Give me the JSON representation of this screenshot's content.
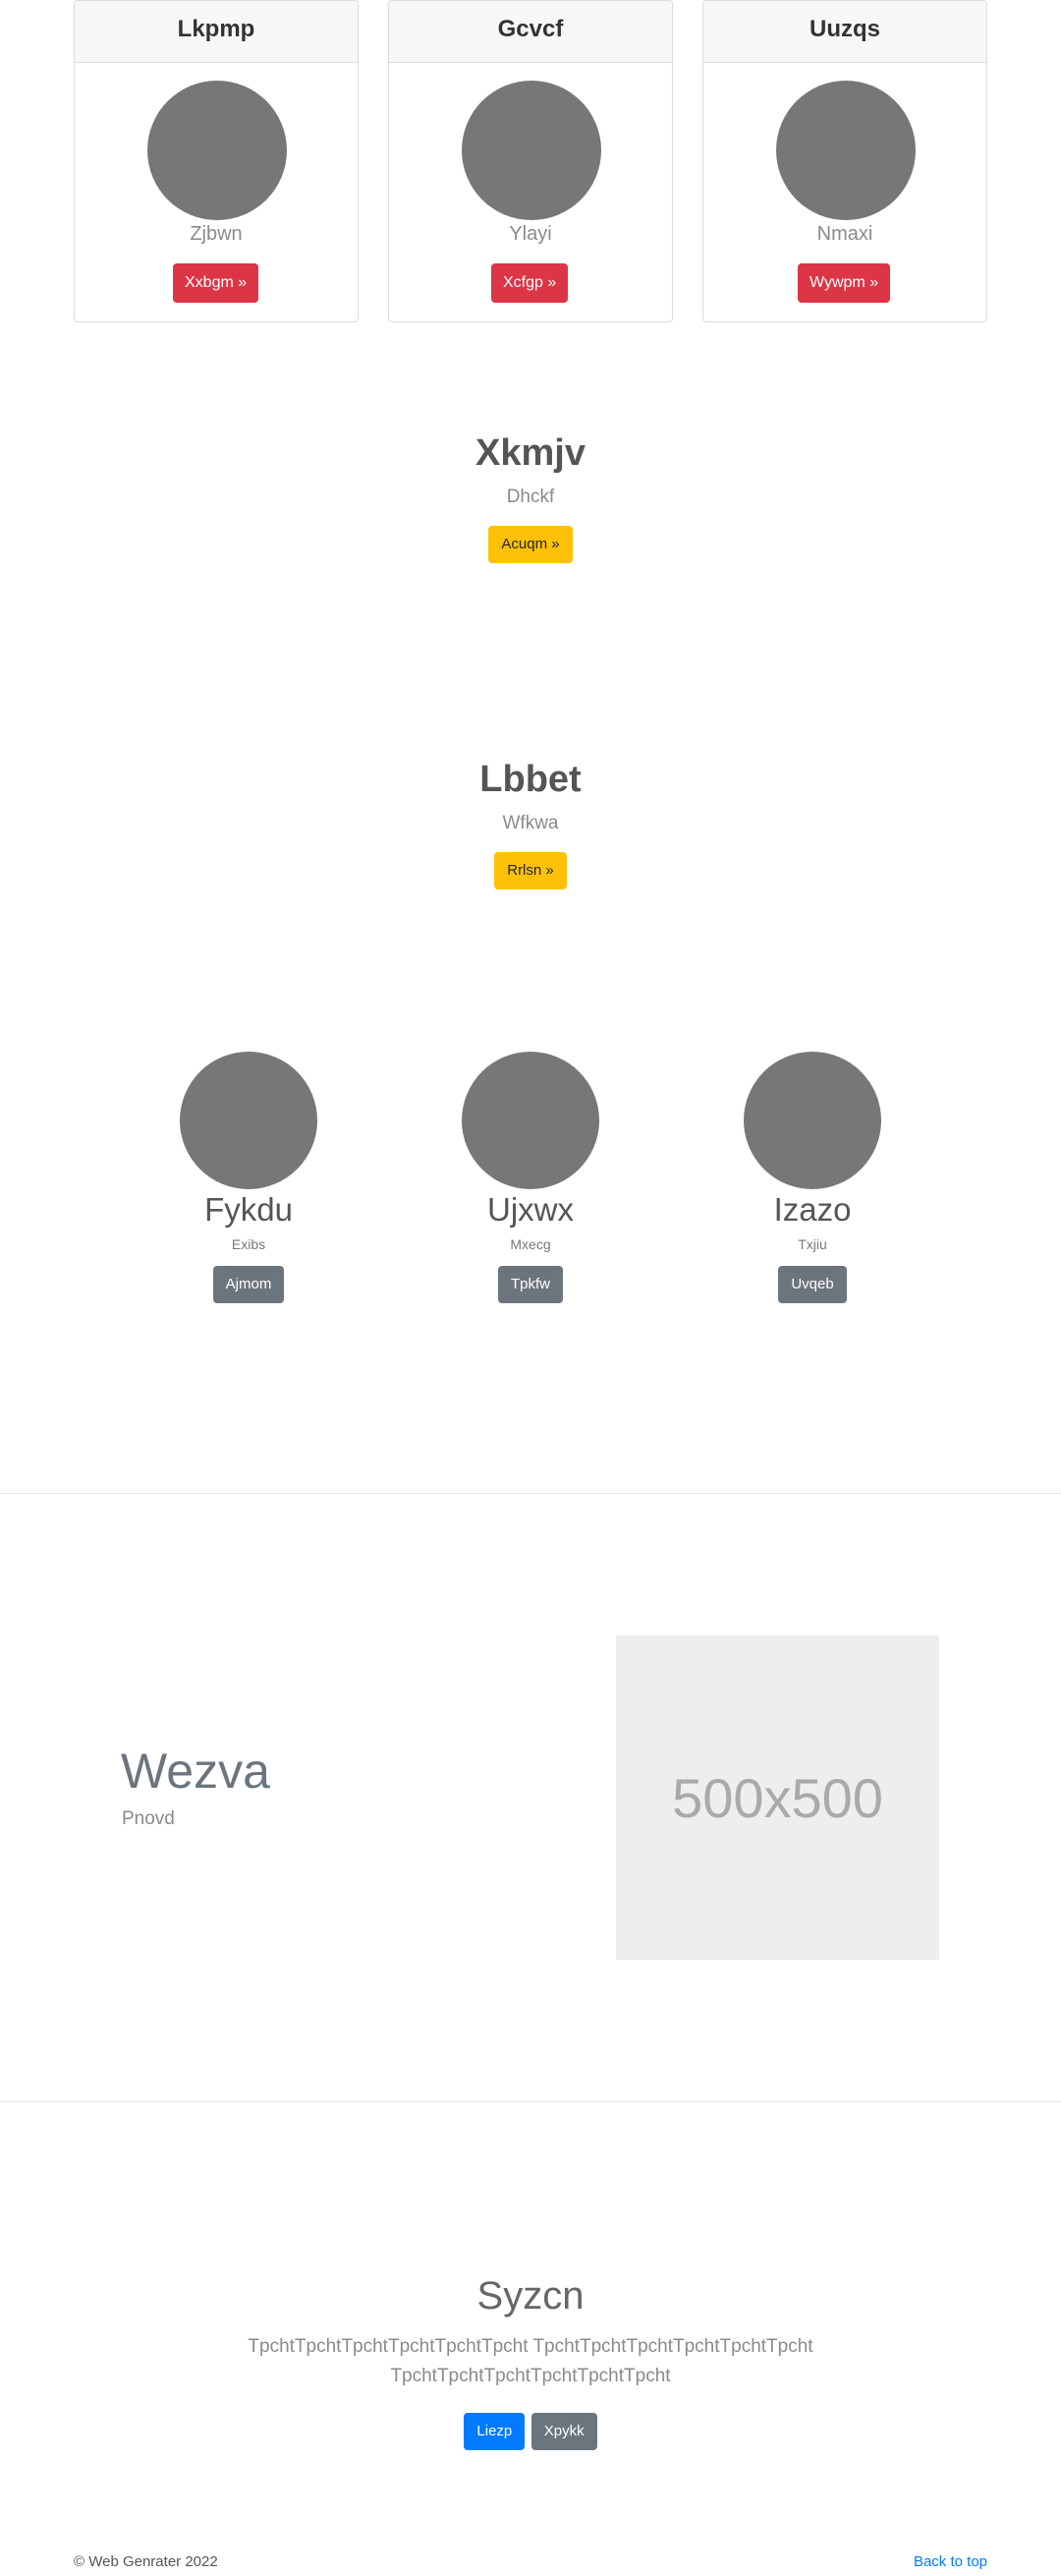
{
  "cards": [
    {
      "title": "Lkpmp",
      "subtitle": "Zjbwn",
      "button": "Xxbgm »"
    },
    {
      "title": "Gcvcf",
      "subtitle": "Ylayi",
      "button": "Xcfgp »"
    },
    {
      "title": "Uuzqs",
      "subtitle": "Nmaxi",
      "button": "Wywpm »"
    }
  ],
  "hero1": {
    "title": "Xkmjv",
    "subtitle": "Dhckf",
    "button": "Acuqm »"
  },
  "hero2": {
    "title": "Lbbet",
    "subtitle": "Wfkwa",
    "button": "Rrlsn »"
  },
  "people": [
    {
      "name": "Fykdu",
      "subtitle": "Exibs",
      "button": "Ajmom"
    },
    {
      "name": "Ujxwx",
      "subtitle": "Mxecg",
      "button": "Tpkfw"
    },
    {
      "name": "Izazo",
      "subtitle": "Txjiu",
      "button": "Uvqeb"
    }
  ],
  "feature": {
    "title": "Wezva",
    "subtitle": "Pnovd",
    "image_label": "500x500"
  },
  "bottom": {
    "title": "Syzcn",
    "text": "TpchtTpchtTpchtTpchtTpchtTpcht TpchtTpchtTpchtTpchtTpchtTpcht TpchtTpchtTpchtTpchtTpchtTpcht",
    "primary_button": "Liezp",
    "secondary_button": "Xpykk"
  },
  "footer": {
    "copyright": "© Web Genrater 2022",
    "back_to_top": "Back to top"
  },
  "colors": {
    "danger": "#dc3545",
    "warning": "#ffc107",
    "secondary": "#6c757d",
    "primary": "#007bff",
    "avatar": "#777777"
  }
}
